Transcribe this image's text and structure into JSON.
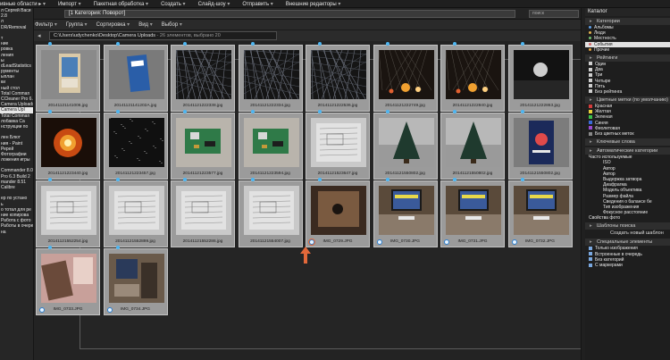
{
  "menubar": {
    "items": [
      "ивные области ▸",
      "Импорт",
      "Пакетная обработка",
      "Создать",
      "Слайд-шоу",
      "Отправить",
      "Внешние редакторы"
    ]
  },
  "left_panel": {
    "items": [
      "л Сергей Васи",
      "2.8",
      "л",
      "DR/Removal",
      "",
      "т",
      "ние",
      "ровка",
      "ления",
      "ы",
      "dLeadStatistics",
      "рументы",
      "ыплан",
      "ки",
      "ный стол",
      "Total Comman",
      "CCleaner Pro 6.3",
      "Camera Uploads",
      "Camera Upl",
      "Total Comman",
      "лобавка Ca",
      "нструкции по",
      "",
      "лен Блют",
      "ния - Paint",
      "Ререй",
      "Фотографии",
      "ложения игры",
      "",
      "Commander 8.01",
      "Pro 6.3 Build 2",
      "mander 8.51",
      "Calibre",
      "",
      "ер по устано",
      "ь",
      "о тотал для ре",
      "ние копирова",
      "Работа с фото",
      "Работы в очере",
      "на"
    ],
    "selected_index": 18
  },
  "header": {
    "title": "[1 Категория: Поворот]",
    "search_text": "поиск"
  },
  "toolbar": {
    "items": [
      "Фильтр",
      "Группа",
      "Сортировка",
      "Вид",
      "Выбор"
    ]
  },
  "path": {
    "text": "C:\\Users\\udychenko\\Desktop\\Camera Uploads",
    "count": " - 26 элементов, выбрано 20"
  },
  "thumbnails": [
    {
      "label": "20141121141006.jpg",
      "scene": "portrait-photo"
    },
    {
      "label": "20141121141202A.jpg",
      "scene": "blue-card"
    },
    {
      "label": "20141121222338.jpg",
      "scene": "dark-branches"
    },
    {
      "label": "20141121222334.jpg",
      "scene": "dark-branches"
    },
    {
      "label": "20141121222536.jpg",
      "scene": "dark-branches"
    },
    {
      "label": "20141121222749.jpg",
      "scene": "night-lights"
    },
    {
      "label": "20141121222840.jpg",
      "scene": "night-lights"
    },
    {
      "label": "20141121222863.jpg",
      "scene": "dark-light"
    },
    {
      "label": "20141121223440.jpg",
      "scene": "fire"
    },
    {
      "label": "20141121223457.jpg",
      "scene": "dark-texture"
    },
    {
      "label": "20141121223577.jpg",
      "scene": "green-board"
    },
    {
      "label": "20141121223594.jpg",
      "scene": "green-board"
    },
    {
      "label": "20141121523647.jpg",
      "scene": "paper-sketch"
    },
    {
      "label": "20141121550802.jpg",
      "scene": "christmas-tree"
    },
    {
      "label": "20141121550802.jpg",
      "scene": "christmas-tree"
    },
    {
      "label": "20141121550802.jpg",
      "scene": "poster"
    },
    {
      "label": "20141121552254.jpg",
      "scene": "paper-sketch"
    },
    {
      "label": "20141121552899.jpg",
      "scene": "paper-sketch"
    },
    {
      "label": "20141121552286.jpg",
      "scene": "paper-sketch"
    },
    {
      "label": "20141121554007.jpg",
      "scene": "paper-sketch"
    },
    {
      "label": "IMG_0729.JPG",
      "scene": "box-photo"
    },
    {
      "label": "IMG_0730.JPG",
      "scene": "monitor-desk"
    },
    {
      "label": "IMG_0731.JPG",
      "scene": "monitor-desk"
    },
    {
      "label": "IMG_0732.JPG",
      "scene": "monitor-desk"
    },
    {
      "label": "IMG_0733.JPG",
      "scene": "pink-room"
    },
    {
      "label": "IMG_0734.JPG",
      "scene": "office-photo"
    }
  ],
  "catalog": {
    "title": "Каталог",
    "sections": [
      {
        "title": "Категории",
        "rows": [
          {
            "label": "Альбомы",
            "marker": "dot",
            "color": "#5fa0e8"
          },
          {
            "label": "Люди",
            "marker": "dot",
            "color": "#e0b050"
          },
          {
            "label": "Местность",
            "marker": "dot",
            "color": "#70c070"
          },
          {
            "label": "События",
            "marker": "dot",
            "color": "#d46a6a",
            "selected": true
          },
          {
            "label": "Прочие",
            "marker": "dot",
            "color": "#e0a040"
          }
        ]
      },
      {
        "title": "Рейтинги",
        "rows": [
          {
            "label": "Один",
            "marker": "box",
            "color": "#cfcfcf"
          },
          {
            "label": "Два",
            "marker": "box",
            "color": "#cfcfcf"
          },
          {
            "label": "Три",
            "marker": "box",
            "color": "#cfcfcf"
          },
          {
            "label": "Четыре",
            "marker": "box",
            "color": "#cfcfcf"
          },
          {
            "label": "Пять",
            "marker": "box",
            "color": "#cfcfcf"
          },
          {
            "label": "Без рейтинга",
            "marker": "box",
            "color": "#cfcfcf"
          }
        ]
      },
      {
        "title": "Цветные метки (по умолчанию)",
        "rows": [
          {
            "label": "Красная",
            "marker": "box",
            "color": "#d33c3c"
          },
          {
            "label": "Желтая",
            "marker": "box",
            "color": "#e8d13a"
          },
          {
            "label": "Зеленая",
            "marker": "box",
            "color": "#3ac04a"
          },
          {
            "label": "Синяя",
            "marker": "box",
            "color": "#3a6ad8"
          },
          {
            "label": "Фиолетовая",
            "marker": "box",
            "color": "#9a4ad0"
          },
          {
            "label": "Без цветных меток",
            "marker": "box",
            "color": "#888888"
          }
        ]
      },
      {
        "title": "Ключевые слова",
        "rows": []
      },
      {
        "title": "Автоматические категории",
        "rows": [
          {
            "label": "Часто используемые",
            "marker": "none",
            "color": ""
          },
          {
            "label": "ISO",
            "marker": "none",
            "color": "",
            "indent": true
          },
          {
            "label": "Автор",
            "marker": "none",
            "color": "",
            "indent": true
          },
          {
            "label": "Автор",
            "marker": "none",
            "color": "",
            "indent": true
          },
          {
            "label": "Выдержка затвора",
            "marker": "none",
            "color": "",
            "indent": true
          },
          {
            "label": "Диафрагма",
            "marker": "none",
            "color": "",
            "indent": true
          },
          {
            "label": "Модель объектива",
            "marker": "none",
            "color": "",
            "indent": true
          },
          {
            "label": "Размер файла",
            "marker": "none",
            "color": "",
            "indent": true
          },
          {
            "label": "Сведения о балансе бе",
            "marker": "none",
            "color": "",
            "indent": true
          },
          {
            "label": "Тип изображения",
            "marker": "none",
            "color": "",
            "indent": true
          },
          {
            "label": "Фокусное расстояние",
            "marker": "none",
            "color": "",
            "indent": true
          },
          {
            "label": "Свойства фото",
            "marker": "none",
            "color": ""
          }
        ]
      },
      {
        "title": "Шаблоны поиска",
        "rows": []
      }
    ],
    "create_template_label": "Создать новый шаблон поиска",
    "special": {
      "title": "Специальные элементы",
      "rows": [
        {
          "label": "Только изображения",
          "marker": "box",
          "color": "#7aa8e0"
        },
        {
          "label": "Встроенные в очередь",
          "marker": "box",
          "color": "#7aa8e0"
        },
        {
          "label": "Без категорий",
          "marker": "box",
          "color": "#7aa8e0"
        },
        {
          "label": "С маркерами",
          "marker": "box",
          "color": "#7aa8e0"
        }
      ]
    }
  },
  "colors": {
    "accent_arrow": "#e2683a",
    "flag_blue": "#4db6f2"
  }
}
